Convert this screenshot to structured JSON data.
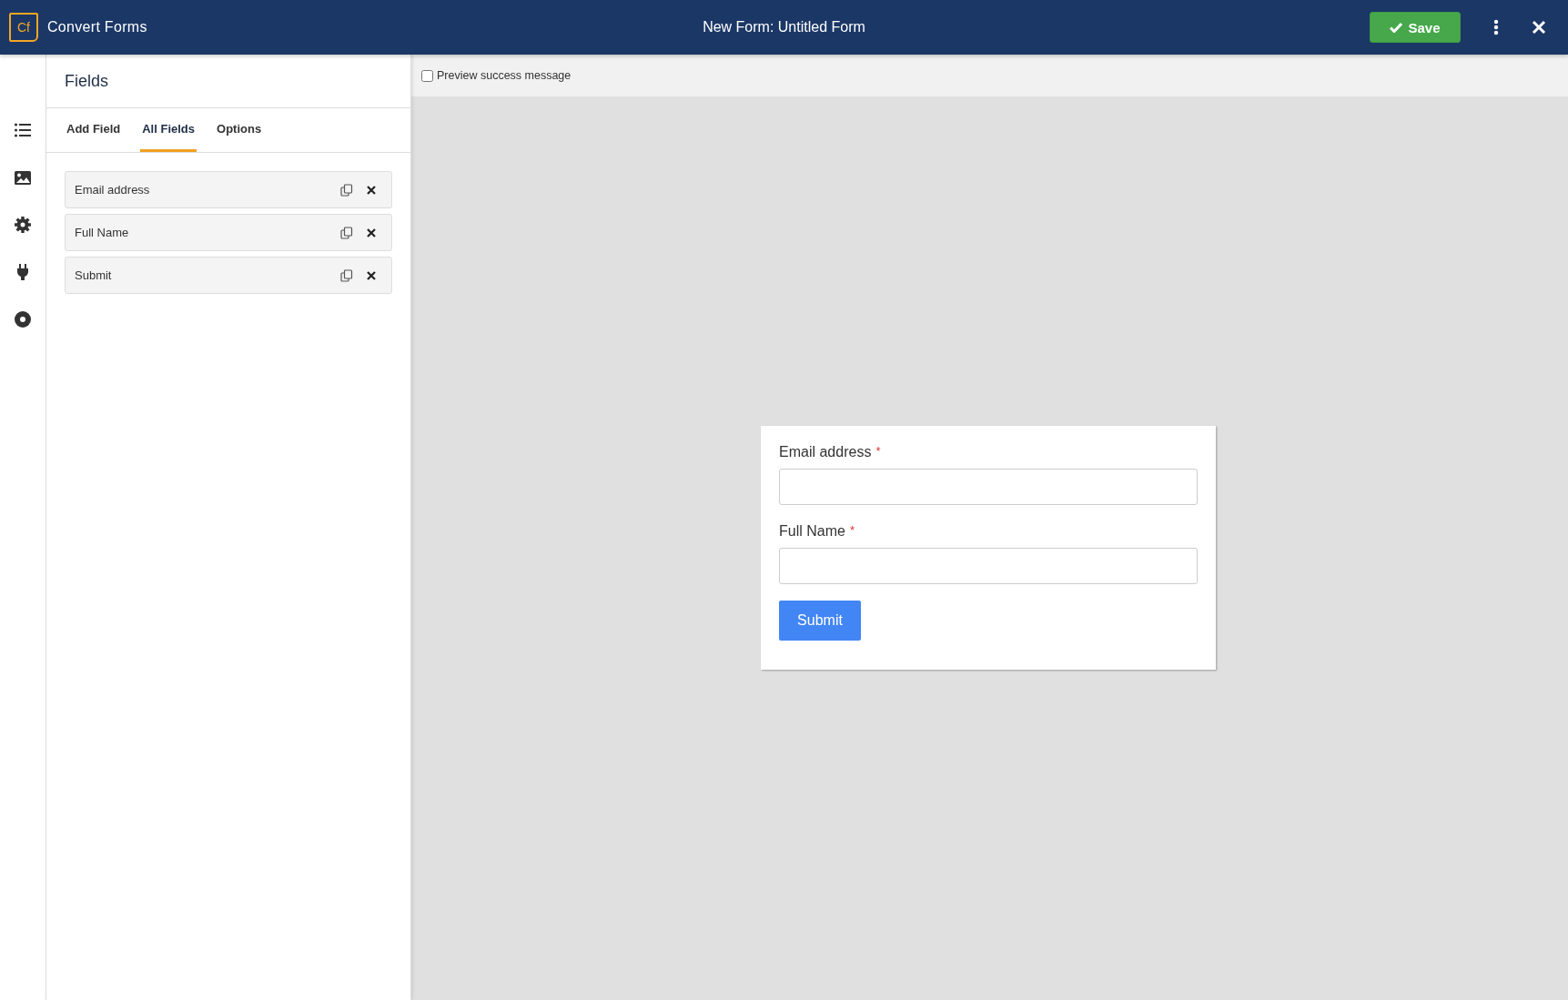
{
  "header": {
    "logo": "Cf",
    "app_name": "Convert Forms",
    "title_prefix": "New Form:",
    "title": "Untitled Form",
    "save_label": "Save"
  },
  "rail": [
    {
      "kind": "list",
      "selected": false
    },
    {
      "kind": "image",
      "selected": false
    },
    {
      "kind": "gear",
      "selected": false
    },
    {
      "kind": "plug",
      "selected": false
    },
    {
      "kind": "circle",
      "selected": false
    }
  ],
  "panel": {
    "title": "Fields",
    "tabs": [
      {
        "label": "Add Field",
        "selected": false
      },
      {
        "label": "All Fields",
        "selected": true
      },
      {
        "label": "Options",
        "selected": false
      }
    ],
    "fields": [
      {
        "label": "Email address"
      },
      {
        "label": "Full Name"
      },
      {
        "label": "Submit"
      }
    ]
  },
  "preview": {
    "checkbox_label": "Preview success message",
    "checked": false
  },
  "form": {
    "required_mark": "*",
    "inputs": [
      {
        "label": "Email address",
        "required": true
      },
      {
        "label": "Full Name",
        "required": true
      }
    ],
    "submit_label": "Submit"
  }
}
